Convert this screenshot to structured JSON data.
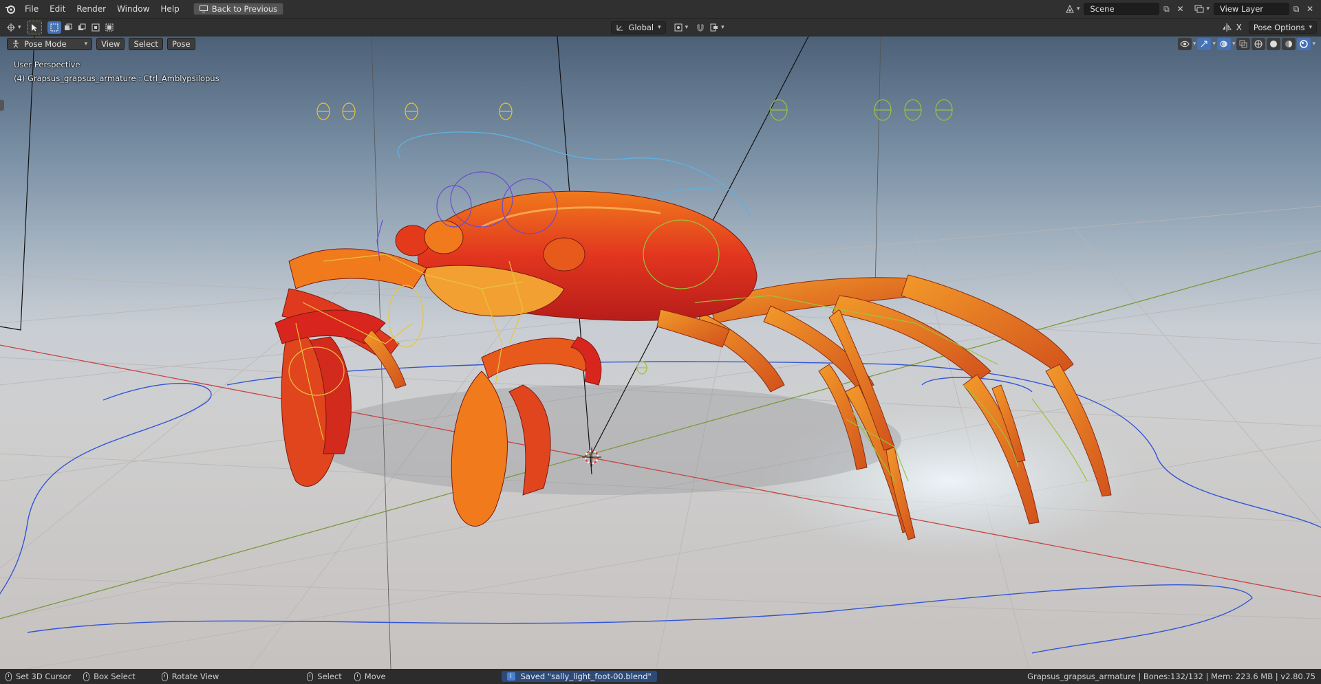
{
  "topbar": {
    "menus": [
      "File",
      "Edit",
      "Render",
      "Window",
      "Help"
    ],
    "back_button": "Back to Previous",
    "scene_label": "Scene",
    "view_layer_label": "View Layer"
  },
  "header": {
    "mode": "Pose Mode",
    "menus": [
      "View",
      "Select",
      "Pose"
    ],
    "transform_orientation": "Global",
    "pose_options": "Pose Options",
    "x_mirror_label": "X"
  },
  "viewport": {
    "perspective_label": "User Perspective",
    "active_object_label": "(4) Grapsus_grapsus_armature : Ctrl_Amblypsilopus"
  },
  "statusbar": {
    "hints": [
      {
        "icon": "mouse-left-icon",
        "label": "Set 3D Cursor"
      },
      {
        "icon": "mouse-right-icon",
        "label": "Box Select"
      },
      {
        "icon": "mouse-middle-icon",
        "label": "Rotate View"
      },
      {
        "icon": "mouse-left-icon",
        "label": "Select"
      },
      {
        "icon": "mouse-right-icon",
        "label": "Move"
      }
    ],
    "report": "Saved \"sally_light_foot-00.blend\"",
    "stats": "Grapsus_grapsus_armature | Bones:132/132 | Mem: 223.6 MB | v2.80.75"
  },
  "colors": {
    "accent": "#4772b3",
    "crab_red": "#d8261e",
    "crab_orange": "#f07a1c",
    "bone_yellow": "#e8c53a",
    "bone_green": "#9ac43a",
    "curve_blue": "#3355d6",
    "curve_cyan": "#5fb0e0",
    "axis_red": "#c64545",
    "axis_green": "#7a9a3a"
  }
}
